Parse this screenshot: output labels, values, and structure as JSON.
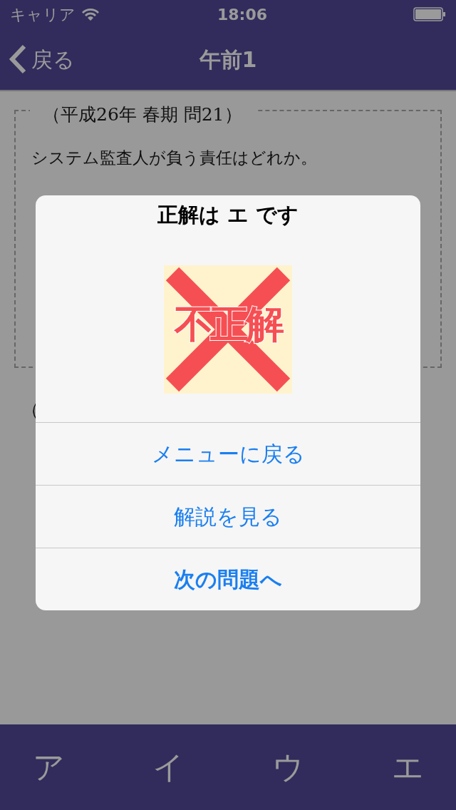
{
  "status_bar": {
    "carrier": "キャリア",
    "time": "18:06"
  },
  "nav": {
    "back": "戻る",
    "title": "午前1"
  },
  "question": {
    "source": "（平成26年 春期 問21）",
    "text": "システム監査人が負う責任はどれか。",
    "answer_note": "（"
  },
  "alert": {
    "title": "正解は エ です",
    "result": "不正解",
    "kind": "incorrect",
    "actions": [
      {
        "label": "メニューに戻る",
        "bold": false
      },
      {
        "label": "解説を見る",
        "bold": false
      },
      {
        "label": "次の問題へ",
        "bold": true
      }
    ]
  },
  "answers": [
    {
      "label": "ア"
    },
    {
      "label": "イ"
    },
    {
      "label": "ウ"
    },
    {
      "label": "エ"
    }
  ]
}
